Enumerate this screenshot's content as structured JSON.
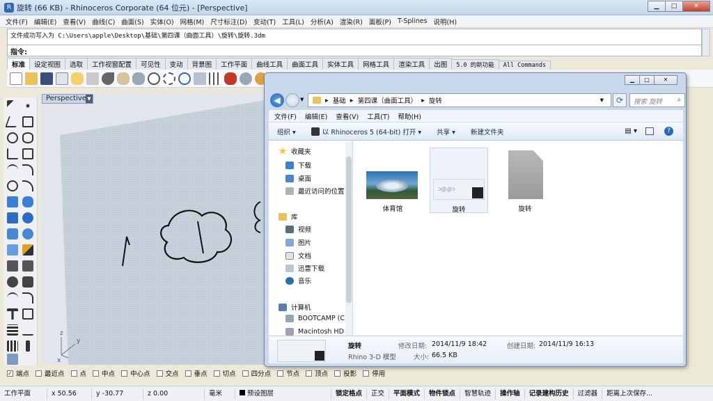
{
  "window": {
    "title": "旋转 (66 KB) - Rhinoceros Corporate (64 位元) - [Perspective]",
    "min": "▁",
    "max": "□",
    "close": "✕"
  },
  "menu": [
    "文件(F)",
    "编辑(E)",
    "查看(V)",
    "曲线(C)",
    "曲面(S)",
    "实体(O)",
    "网格(M)",
    "尺寸标注(D)",
    "变动(T)",
    "工具(L)",
    "分析(A)",
    "渲染(R)",
    "面板(P)",
    "T-Splines",
    "说明(H)"
  ],
  "command": {
    "history": "文件成功写入为 C:\\Users\\apple\\Desktop\\基础\\第四课（曲面工具）\\旋转\\旋转.3dm",
    "prompt": "指令:"
  },
  "tabs": [
    "标准",
    "设定视图",
    "选取",
    "工作视窗配置",
    "可见性",
    "变动",
    "背景图",
    "工作平面",
    "曲线工具",
    "曲面工具",
    "实体工具",
    "网格工具",
    "渲染工具",
    "出图",
    "5.0 的新功能",
    "All Commands"
  ],
  "viewport": {
    "label": "Perspective",
    "axes": {
      "z": "z",
      "y": "y",
      "x": "x"
    }
  },
  "explorer": {
    "breadcrumb": [
      "基础",
      "第四课（曲面工具）",
      "旋转"
    ],
    "search_placeholder": "搜索 旋转",
    "menu": [
      "文件(F)",
      "编辑(E)",
      "查看(V)",
      "工具(T)",
      "帮助(H)"
    ],
    "commands": {
      "organize": "组织 ▾",
      "open_with": "以 Rhinoceros 5 (64-bit) 打开 ▾",
      "share": "共享 ▾",
      "new_folder": "新建文件夹"
    },
    "nav": {
      "favorites": "收藏夹",
      "downloads": "下载",
      "desktop": "桌面",
      "recent": "最近访问的位置",
      "libraries": "库",
      "videos": "视频",
      "pictures": "图片",
      "documents": "文档",
      "xunlei": "迅雷下载",
      "music": "音乐",
      "computer": "计算机",
      "bootcamp": "BOOTCAMP (C:",
      "macintosh": "Macintosh HD ("
    },
    "files": [
      "体育馆",
      "旋转",
      "旋转"
    ],
    "details": {
      "name": "旋转",
      "type": "Rhino 3-D 模型",
      "modified_label": "修改日期:",
      "modified": "2014/11/9 18:42",
      "created_label": "创建日期:",
      "created": "2014/11/9 16:13",
      "size_label": "大小:",
      "size": "66.5 KB"
    }
  },
  "osnap": [
    "端点",
    "最近点",
    "点",
    "中点",
    "中心点",
    "交点",
    "垂点",
    "切点",
    "四分点",
    "节点",
    "顶点",
    "投影",
    "停用"
  ],
  "status": {
    "plane": "工作平面",
    "x": "x 50.56",
    "y": "y -30.77",
    "z": "z 0.00",
    "unit": "毫米",
    "layer": "预设图层",
    "grid_snap": "锁定格点",
    "ortho": "正交",
    "planar": "平面模式",
    "osnap": "物件锁点",
    "smarttrack": "智慧轨迹",
    "gumball": "操作轴",
    "history": "记录建构历史",
    "filter": "过滤器",
    "autosave": "距离上次保存..."
  }
}
